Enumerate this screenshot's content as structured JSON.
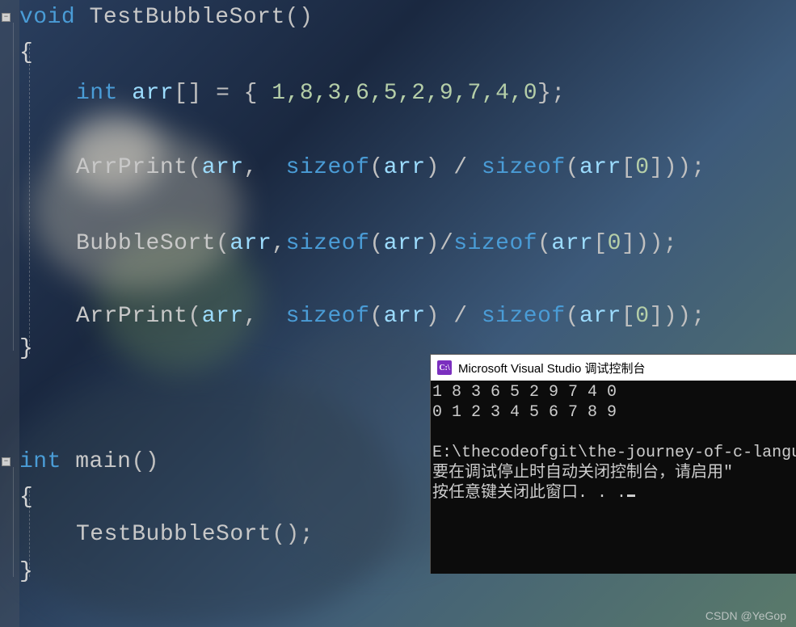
{
  "code": {
    "l1_void": "void",
    "l1_fn": " TestBubbleSort",
    "l1_par": "()",
    "l2": "{",
    "l3_int": "int",
    "l3_arr": " arr",
    "l3_br": "[] ",
    "l3_eq": "= { ",
    "l3_nums": "1,8,3,6,5,2,9,7,4,0",
    "l3_end": "};",
    "l5_fn": "ArrPrint",
    "l5_open": "(",
    "l5_arr": "arr",
    "l5_c1": ", ",
    "l5_sizeof1": "sizeof",
    "l5_p1": "(",
    "l5_arr2": "arr",
    "l5_p2": ") / ",
    "l5_sizeof2": "sizeof",
    "l5_p3": "(",
    "l5_arr3": "arr",
    "l5_idx": "[",
    "l5_zero": "0",
    "l5_idx2": "]",
    "l5_close": "));",
    "l7_fn": "BubbleSort",
    "l7_open": "(",
    "l7_arr": "arr",
    "l7_c1": ",",
    "l7_sizeof1": "sizeof",
    "l7_p1": "(",
    "l7_arr2": "arr",
    "l7_p2": ")/",
    "l7_sizeof2": "sizeof",
    "l7_p3": "(",
    "l7_arr3": "arr",
    "l7_idx": "[",
    "l7_zero": "0",
    "l7_idx2": "]",
    "l7_close": "));",
    "l9_fn": "ArrPrint",
    "l9_open": "(",
    "l9_arr": "arr",
    "l9_c1": ", ",
    "l9_sizeof1": "sizeof",
    "l9_p1": "(",
    "l9_arr2": "arr",
    "l9_p2": ") / ",
    "l9_sizeof2": "sizeof",
    "l9_p3": "(",
    "l9_arr3": "arr",
    "l9_idx": "[",
    "l9_zero": "0",
    "l9_idx2": "]",
    "l9_close": "));",
    "l10": "}",
    "l12_int": "int",
    "l12_main": " main",
    "l12_par": "()",
    "l13": "{",
    "l14_fn": "TestBubbleSort",
    "l14_par": "();",
    "l15": "}"
  },
  "console": {
    "icon_text": "C:\\",
    "title": "Microsoft Visual Studio 调试控制台",
    "line1": "1 8 3 6 5 2 9 7 4 0",
    "line2": "0 1 2 3 4 5 6 7 8 9",
    "blank": "",
    "line3": "E:\\thecodeofgit\\the-journey-of-c-langu",
    "line4": "要在调试停止时自动关闭控制台，请启用\"",
    "line5": "按任意键关闭此窗口. . ."
  },
  "fold": {
    "minus": "−"
  },
  "watermark": "CSDN @YeGop"
}
